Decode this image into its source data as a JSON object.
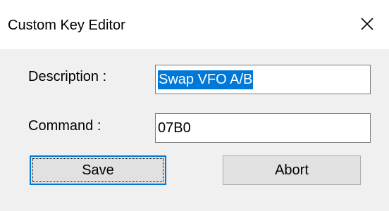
{
  "window": {
    "title": "Custom Key Editor",
    "close_icon": "close-icon"
  },
  "form": {
    "description_label": "Description :",
    "description_value": "Swap VFO A/B",
    "description_selected": true,
    "command_label": "Command :",
    "command_value": "07B0"
  },
  "buttons": {
    "save_label": "Save",
    "abort_label": "Abort"
  },
  "colors": {
    "selection": "#0078d7",
    "dialog_background": "#f0f0f0",
    "title_background": "#ffffff"
  }
}
